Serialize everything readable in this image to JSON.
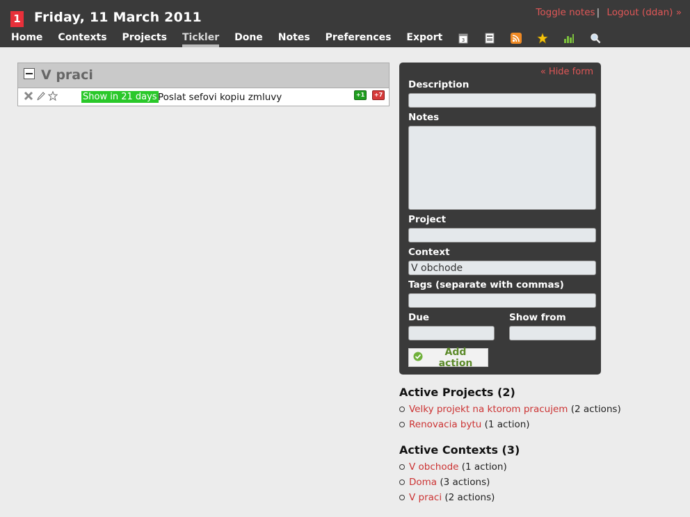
{
  "header": {
    "badge": "1",
    "date": "Friday, 11 March 2011",
    "toggle_notes": "Toggle notes",
    "separator": "|",
    "logout": "Logout (ddan) »"
  },
  "nav": {
    "items": [
      "Home",
      "Contexts",
      "Projects",
      "Tickler",
      "Done",
      "Notes",
      "Preferences",
      "Export"
    ],
    "active": "Tickler",
    "icons": [
      "calendar-icon",
      "print-icon",
      "rss-icon",
      "star-icon",
      "stats-icon",
      "search-icon"
    ]
  },
  "context": {
    "title": "V praci",
    "todos": [
      {
        "show_badge": "Show in 21 days",
        "description": "Poslat sefovi kopiu zmluvy",
        "defer_plus1": "+1",
        "defer_plus7": "+7"
      }
    ]
  },
  "form": {
    "hide_form": "« Hide form",
    "description_label": "Description",
    "description_value": "",
    "notes_label": "Notes",
    "notes_value": "",
    "project_label": "Project",
    "project_value": "",
    "context_label": "Context",
    "context_value": "V obchode",
    "tags_label": "Tags (separate with commas)",
    "tags_value": "",
    "due_label": "Due",
    "due_value": "",
    "show_from_label": "Show from",
    "show_from_value": "",
    "add_button": "Add action"
  },
  "sidebar": {
    "projects_title": "Active Projects (2)",
    "projects": [
      {
        "name": "Velky projekt na ktorom pracujem",
        "count": "(2 actions)"
      },
      {
        "name": "Renovacia bytu",
        "count": "(1 action)"
      }
    ],
    "contexts_title": "Active Contexts (3)",
    "contexts": [
      {
        "name": "V obchode",
        "count": "(1 action)"
      },
      {
        "name": "Doma",
        "count": "(3 actions)"
      },
      {
        "name": "V praci",
        "count": "(2 actions)"
      }
    ]
  },
  "colors": {
    "header_bg": "#3a3a3a",
    "link": "#cc3333",
    "badge_green": "#2ac82a",
    "badge_red": "#e8303a"
  }
}
